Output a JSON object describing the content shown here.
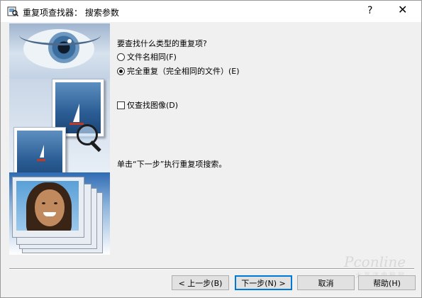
{
  "window": {
    "title": "重复项查找器：  搜索参数",
    "help_glyph": "?",
    "close_glyph": "✕"
  },
  "main": {
    "question": "要查找什么类型的重复项?",
    "options": [
      {
        "label": "文件名相同(F)",
        "selected": false
      },
      {
        "label": "完全重复（完全相同的文件）(E)",
        "selected": true
      }
    ],
    "checkbox": {
      "label": "仅查找图像(D)",
      "checked": false
    },
    "info": "单击“下一步”执行重复项搜索。"
  },
  "buttons": {
    "back": "< 上一步(B)",
    "next": "下一步(N) >",
    "cancel": "取消",
    "help": "帮助(H)"
  },
  "watermark": {
    "brand": "Pconline",
    "sub": "太平洋电脑网"
  },
  "colors": {
    "dialog_bg": "#f0f0f0",
    "default_button_border": "#0078d7",
    "button_bg": "#e1e1e1"
  }
}
